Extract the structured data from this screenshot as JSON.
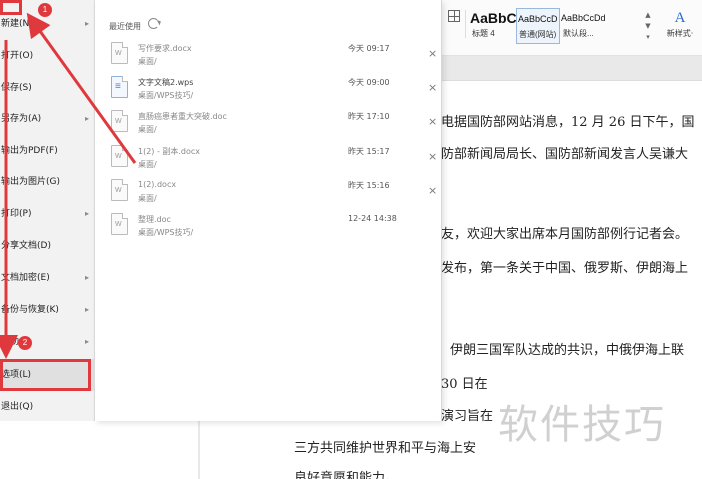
{
  "ribbon": {
    "styles": [
      {
        "sample": "AaBbC",
        "name": "标题 4"
      },
      {
        "sample": "AaBbCcD",
        "name": "普通(网站)"
      },
      {
        "sample": "AaBbCcDd",
        "name": "默认段..."
      }
    ],
    "new_style_glyph": "A",
    "new_style_label": "新样式·"
  },
  "file_menu": {
    "items": [
      {
        "label": "新建(N)",
        "arrow": "▸"
      },
      {
        "label": "打开(O)"
      },
      {
        "label": "保存(S)"
      },
      {
        "label": "另存为(A)",
        "arrow": "▸"
      },
      {
        "label": "输出为PDF(F)"
      },
      {
        "label": "输出为图片(G)"
      },
      {
        "label": "打印(P)",
        "arrow": "▸"
      },
      {
        "label": "分享文档(D)"
      },
      {
        "label": "文档加密(E)",
        "arrow": "▸"
      },
      {
        "label": "备份与恢复(K)",
        "arrow": "▸"
      },
      {
        "label": "帮助",
        "arrow": "▸"
      },
      {
        "label": "选项(L)"
      },
      {
        "label": "退出(Q)"
      }
    ]
  },
  "recent": {
    "title": "最近使用",
    "files": [
      {
        "name": "写作要求.docx",
        "path": "桌面/",
        "time": "今天 09:17",
        "type": "doc",
        "close": "×"
      },
      {
        "name": "文字文稿2.wps",
        "path": "桌面/WPS技巧/",
        "time": "今天 09:00",
        "type": "wps",
        "close": "×"
      },
      {
        "name": "直肠癌患者重大突破.doc",
        "path": "桌面/",
        "time": "昨天 17:10",
        "type": "doc",
        "close": "×"
      },
      {
        "name": "1(2) - 副本.docx",
        "path": "桌面/",
        "time": "昨天 15:17",
        "type": "doc",
        "close": "×"
      },
      {
        "name": "1(2).docx",
        "path": "桌面/",
        "time": "昨天 15:16",
        "type": "doc",
        "close": "×"
      },
      {
        "name": "整理.doc",
        "path": "桌面/WPS技巧/",
        "time": "12-24 14:38",
        "type": "doc",
        "close": ""
      }
    ]
  },
  "document": {
    "lines": [
      "电据国防部网站消息，12 月 26 日下午，国",
      "防部新闻局局长、国防部新闻发言人吴谦大",
      "友，欢迎大家出席本月国防部例行记者会。",
      "发布，第一条关于中国、俄罗斯、伊朗海上",
      "伊朗三国军队达成的共识，中俄伊海上联",
      "30 日在",
      "演习旨在",
      "三方共同维护世界和平与海上安",
      "良好意愿和能力。"
    ]
  },
  "watermark": "软件技巧",
  "annotations": {
    "badge1": "1",
    "badge2": "2",
    "accent": "#e0393d"
  }
}
